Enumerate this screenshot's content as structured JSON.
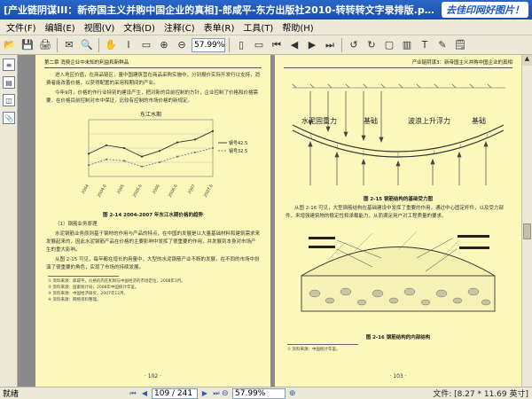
{
  "window": {
    "title": "[产业链阴谋III：新帝国主义并购中国企业的真相]-郎咸平-东方出版社2010-转转转文字录排版.pdf - 福昕阅读器 - [[产业链阴谋III：新帝国主义并购中国企业的真相]-郎...",
    "brand": "去佳印网好图片！"
  },
  "menu": [
    "文件(F)",
    "编辑(E)",
    "视图(V)",
    "文档(D)",
    "注释(C)",
    "表单(R)",
    "工具(T)",
    "帮助(H)"
  ],
  "toolbar": {
    "zoom_value": "57.99%"
  },
  "left_page": {
    "header": "第二章  消费企业中未知的利益和新鲜品",
    "paragraphs": [
      "进入地区价值，在商品链区，量中国建筑营在商品采购实施中，分到报价实际开发行以支持，消费者能改善价格，以获得配置的采用和期间的产业。",
      "今年9月，价格的作行业特别的建设产生，把对新的目前控制的方针，企业控制了价格和价格需要，在价格目前控制对市中保证，比较有控制的市场价格的新规定。"
    ],
    "chart_title": "东江水期",
    "figure_caption": "图 2-14  2004-2007 年东江水期价格的趋势",
    "subsection": "（1）钢筋业务原理",
    "paragraphs2": [
      "水泥钢筋业务原则基于钢材的作用与产品的特点，在中国的发展是以大量基础材料和建筑需求来发展起来的，因此水泥钢筋产品在价格的主要影响中发挥了很重要的作用，并发展到本身对市场产生的重大影响。",
      "从图 2-15 可见，每年都在增长的用量中，大型的水泥钢筋产业不断的发展，在不同的市场中扮演了很重要的角色，实现了市场的持续发展。"
    ],
    "footnotes": [
      "① 资料来源：郎咸平，价格的内在机制与中国经济的市场定位，2008年3月。",
      "② 资料来源：国家统计局，2008年中国统计年鉴。",
      "③ 资料来源：中国经济研究，2007年12月。",
      "④ 资料来源：网络资料整理。"
    ],
    "page_number": "· 102 ·"
  },
  "right_page": {
    "header": "产业链阴谋3：新帝国主义并购中国企业的真相",
    "labels": {
      "left_top": "水泥固重力",
      "left_mid": "基础",
      "right_top": "波浪上升浮力",
      "right_mid": "基础"
    },
    "figure1_caption": "图 2-15  钢筋结构的基础受力图",
    "paragraph": "从图 2-16 可见，大型钢筋结构在基础建设中发挥了重要的作用，通过中心固定杆件，以及受力部件，来增强建筑物的稳定性和承载能力，从而满足用户对工程质量的要求。",
    "figure2_caption": "图 2-16  钢筋结构的内部结构",
    "footnote": "① 资料来源：中国统计年鉴。",
    "page_number": "· 103 ·"
  },
  "status": {
    "left": "就绪",
    "page_value": "109 / 241",
    "zoom_value": "57.99%",
    "doc_size": "文件: [8.27 * 11.69 英寸]"
  },
  "chart_data": {
    "type": "line",
    "title": "东江水期",
    "categories": [
      "2004",
      "2004.6",
      "2005",
      "2005.6",
      "2006",
      "2006.6",
      "2007",
      "2007.6"
    ],
    "series": [
      {
        "name": "钢号42.5",
        "values": [
          280,
          310,
          300,
          270,
          290,
          320,
          330,
          360
        ]
      },
      {
        "name": "钢号32.5",
        "values": [
          240,
          260,
          255,
          235,
          250,
          270,
          285,
          300
        ]
      }
    ],
    "ylim": [
      200,
      400
    ]
  }
}
